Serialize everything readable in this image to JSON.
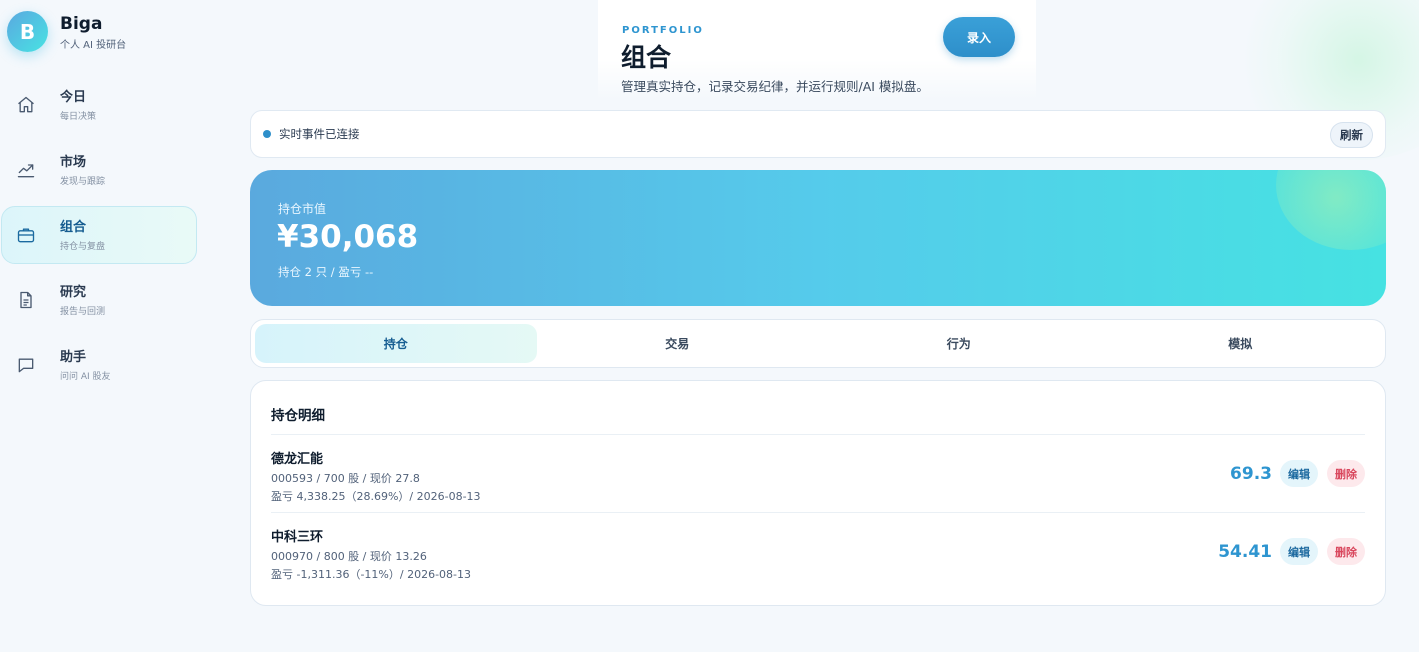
{
  "brand": {
    "logo_letter": "B",
    "name": "Biga",
    "subtitle": "个人 AI 投研台"
  },
  "nav": [
    {
      "label": "今日",
      "sub": "每日决策",
      "icon": "home-icon",
      "active": false
    },
    {
      "label": "市场",
      "sub": "发现与跟踪",
      "icon": "trend-icon",
      "active": false
    },
    {
      "label": "组合",
      "sub": "持仓与复盘",
      "icon": "briefcase-icon",
      "active": true
    },
    {
      "label": "研究",
      "sub": "报告与回测",
      "icon": "document-icon",
      "active": false
    },
    {
      "label": "助手",
      "sub": "问问 AI 股友",
      "icon": "chat-icon",
      "active": false
    }
  ],
  "header": {
    "eyebrow": "PORTFOLIO",
    "title": "组合",
    "description": "管理真实持仓，记录交易纪律，并运行规则/AI 模拟盘。",
    "record_button": "录入"
  },
  "status": {
    "text": "实时事件已连接",
    "refresh_label": "刷新",
    "dot_color": "#2e8fca"
  },
  "hero": {
    "label": "持仓市值",
    "value": "¥30,068",
    "sub": "持仓 2 只 / 盈亏 --"
  },
  "tabs": [
    {
      "label": "持仓",
      "active": true
    },
    {
      "label": "交易",
      "active": false
    },
    {
      "label": "行为",
      "active": false
    },
    {
      "label": "模拟",
      "active": false
    }
  ],
  "holdings": {
    "title": "持仓明细",
    "edit_label": "编辑",
    "delete_label": "删除",
    "rows": [
      {
        "name": "德龙汇能",
        "meta": "000593 / 700 股 / 现价 27.8",
        "pnl": "盈亏 4,338.25（28.69%）/ 2026-08-13",
        "value": "69.3"
      },
      {
        "name": "中科三环",
        "meta": "000970 / 800 股 / 现价 13.26",
        "pnl": "盈亏 -1,311.36（-11%）/ 2026-08-13",
        "value": "54.41"
      }
    ]
  },
  "colors": {
    "accent": "#2e95d0",
    "danger": "#d9475d",
    "hero_start": "#5aa9de",
    "hero_end": "#46e2e2"
  }
}
